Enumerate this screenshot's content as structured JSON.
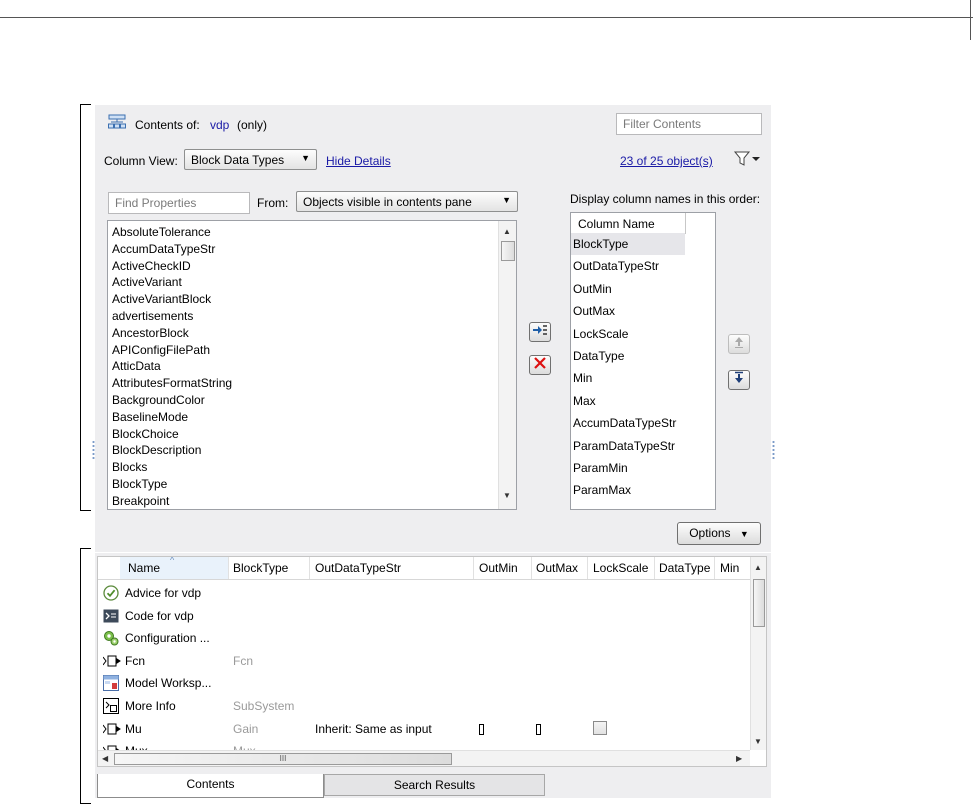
{
  "header": {
    "contents_of_label": "Contents of:",
    "model_link": "vdp",
    "scope": "(only)",
    "filter_placeholder": "Filter Contents"
  },
  "column_view": {
    "label": "Column View:",
    "selected": "Block Data Types",
    "hide_details": "Hide Details",
    "object_count": "23 of 25 object(s)"
  },
  "properties": {
    "find_placeholder": "Find Properties",
    "from_label": "From:",
    "from_selected": "Objects visible in contents pane",
    "items": [
      "AbsoluteTolerance",
      "AccumDataTypeStr",
      "ActiveCheckID",
      "ActiveVariant",
      "ActiveVariantBlock",
      "advertisements",
      "AncestorBlock",
      "APIConfigFilePath",
      "AtticData",
      "AttributesFormatString",
      "BackgroundColor",
      "BaselineMode",
      "BlockChoice",
      "BlockDescription",
      "Blocks",
      "BlockType",
      "Breakpoint"
    ]
  },
  "display_columns": {
    "title": "Display column names in this order:",
    "header": "Column Name",
    "items": [
      "BlockType",
      "OutDataTypeStr",
      "OutMin",
      "OutMax",
      "LockScale",
      "DataType",
      "Min",
      "Max",
      "AccumDataTypeStr",
      "ParamDataTypeStr",
      "ParamMin",
      "ParamMax"
    ]
  },
  "options_label": "Options",
  "table": {
    "columns": [
      "Name",
      "BlockType",
      "OutDataTypeStr",
      "OutMin",
      "OutMax",
      "LockScale",
      "DataType",
      "Min"
    ],
    "rows": [
      {
        "icon": "check-circle-icon",
        "name": "Advice for vdp",
        "blocktype": "",
        "outtype": ""
      },
      {
        "icon": "code-icon",
        "name": "Code for vdp",
        "blocktype": "",
        "outtype": ""
      },
      {
        "icon": "configuration-icon",
        "name": "Configuration ...",
        "blocktype": "",
        "outtype": ""
      },
      {
        "icon": "block-port-icon",
        "name": "Fcn",
        "blocktype": "Fcn",
        "outtype": ""
      },
      {
        "icon": "model-workspace-icon",
        "name": "Model Worksp...",
        "blocktype": "",
        "outtype": ""
      },
      {
        "icon": "info-block-icon",
        "name": "More Info",
        "blocktype": "SubSystem",
        "outtype": ""
      },
      {
        "icon": "block-port-icon",
        "name": "Mu",
        "blocktype": "Gain",
        "outtype": "Inherit: Same as input"
      },
      {
        "icon": "block-port-icon",
        "name": "Mux",
        "blocktype": "Mux",
        "outtype": ""
      }
    ],
    "scroll_thumb_glyph": "III"
  },
  "tabs": [
    "Contents",
    "Search Results"
  ],
  "colors": {
    "panel": "#eeeef0",
    "link": "#1a1aa6",
    "selection": "#e6e6ea"
  }
}
